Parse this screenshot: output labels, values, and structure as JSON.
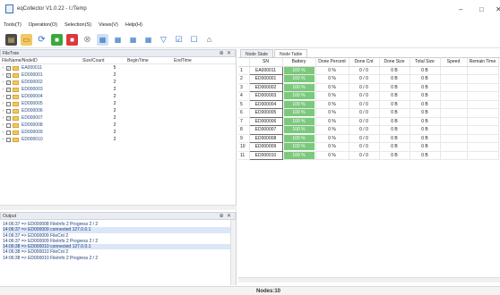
{
  "window": {
    "title": "eqCollector V1.0.22 - I:/Temp",
    "minimize": "–",
    "maximize": "□",
    "close": "✕"
  },
  "menu": [
    "Tools(T)",
    "Operation(O)",
    "Selection(S)",
    "Views(V)",
    "Help(H)"
  ],
  "toolbar_icons": [
    "open-folder-icon",
    "folder-icon",
    "refresh-icon",
    "start-icon",
    "stop-icon",
    "cancel-icon",
    "grid-view-1-icon",
    "grid-view-2-icon",
    "grid-view-3-icon",
    "grid-view-4-icon",
    "filter-icon",
    "check-all-icon",
    "uncheck-all-icon",
    "home-icon"
  ],
  "filetree": {
    "title": "FileTree",
    "pin": "⊕",
    "close": "✕",
    "columns": [
      "FileName/NodeID",
      "Size/Count",
      "BeginTime",
      "EndTime"
    ],
    "rows": [
      {
        "name": "EA000011",
        "count": "5",
        "checked": true
      },
      {
        "name": "ED000001",
        "count": "2",
        "checked": true
      },
      {
        "name": "ED000002",
        "count": "2",
        "checked": true
      },
      {
        "name": "ED000003",
        "count": "2",
        "checked": true
      },
      {
        "name": "ED000004",
        "count": "2",
        "checked": false
      },
      {
        "name": "ED000005",
        "count": "2",
        "checked": false
      },
      {
        "name": "ED000006",
        "count": "2",
        "checked": false
      },
      {
        "name": "ED000007",
        "count": "2",
        "checked": true
      },
      {
        "name": "ED000008",
        "count": "2",
        "checked": false
      },
      {
        "name": "ED000009",
        "count": "2",
        "checked": false
      },
      {
        "name": "ED000010",
        "count": "2",
        "checked": false
      }
    ]
  },
  "output": {
    "title": "Output",
    "pin": "⊕",
    "close": "✕",
    "lines": [
      "14:06:37 => ED000008 FileInfo 2 Progress 2 / 2",
      "14:06:37 => ED000009 connected 127.0.0.1",
      "14:06:37 => ED000009 FileCnt 2",
      "14:06:37 => ED000009 FileInfo 2 Progress 2 / 2",
      "14:06:38 => ED000010 connected 127.0.0.1",
      "14:06:38 => ED000010 FileCnt 2",
      "14:06:38 => ED000010 FileInfo 2 Progress 2 / 2"
    ]
  },
  "tabs": [
    "Node State",
    "Node Table"
  ],
  "node_table": {
    "columns": [
      "SN",
      "Battery",
      "Done Percent",
      "Done Cnt",
      "Done Size",
      "Total Size",
      "Speed",
      "Remain Time"
    ],
    "rows": [
      {
        "n": "1",
        "sn": "EA000011",
        "battery": "100 %",
        "done_pct": "0 %",
        "done_cnt": "0 / 0",
        "done_size": "0 B",
        "total_size": "0 B"
      },
      {
        "n": "2",
        "sn": "ED000001",
        "battery": "100 %",
        "done_pct": "0 %",
        "done_cnt": "0 / 0",
        "done_size": "0 B",
        "total_size": "0 B"
      },
      {
        "n": "3",
        "sn": "ED000002",
        "battery": "100 %",
        "done_pct": "0 %",
        "done_cnt": "0 / 0",
        "done_size": "0 B",
        "total_size": "0 B"
      },
      {
        "n": "4",
        "sn": "ED000003",
        "battery": "100 %",
        "done_pct": "0 %",
        "done_cnt": "0 / 0",
        "done_size": "0 B",
        "total_size": "0 B"
      },
      {
        "n": "5",
        "sn": "ED000004",
        "battery": "100 %",
        "done_pct": "0 %",
        "done_cnt": "0 / 0",
        "done_size": "0 B",
        "total_size": "0 B"
      },
      {
        "n": "6",
        "sn": "ED000005",
        "battery": "100 %",
        "done_pct": "0 %",
        "done_cnt": "0 / 0",
        "done_size": "0 B",
        "total_size": "0 B"
      },
      {
        "n": "7",
        "sn": "ED000006",
        "battery": "100 %",
        "done_pct": "0 %",
        "done_cnt": "0 / 0",
        "done_size": "0 B",
        "total_size": "0 B"
      },
      {
        "n": "8",
        "sn": "ED000007",
        "battery": "100 %",
        "done_pct": "0 %",
        "done_cnt": "0 / 0",
        "done_size": "0 B",
        "total_size": "0 B"
      },
      {
        "n": "9",
        "sn": "ED000008",
        "battery": "100 %",
        "done_pct": "0 %",
        "done_cnt": "0 / 0",
        "done_size": "0 B",
        "total_size": "0 B"
      },
      {
        "n": "10",
        "sn": "ED000009",
        "battery": "100 %",
        "done_pct": "0 %",
        "done_cnt": "0 / 0",
        "done_size": "0 B",
        "total_size": "0 B"
      },
      {
        "n": "11",
        "sn": "ED000010",
        "battery": "100 %",
        "done_pct": "0 %",
        "done_cnt": "0 / 0",
        "done_size": "0 B",
        "total_size": "0 B"
      }
    ]
  },
  "status": {
    "nodes": "Nodes:10"
  },
  "colors": {
    "battery_fill": "#7bc97b",
    "folder": "#f1c863",
    "log_text": "#1d3f7a"
  }
}
